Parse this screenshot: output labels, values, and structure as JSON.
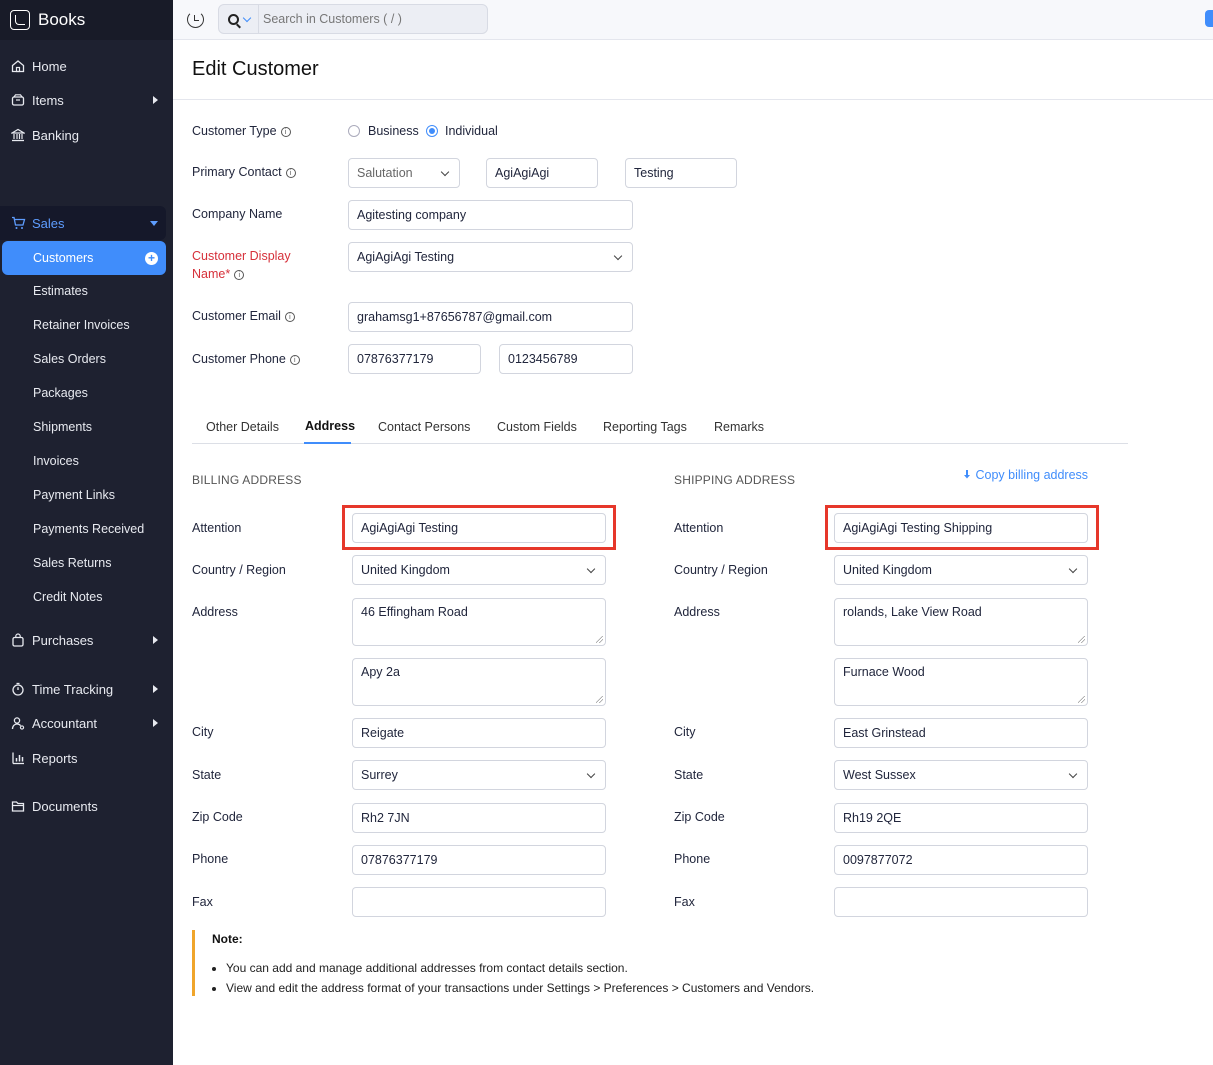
{
  "brand": {
    "name": "Books"
  },
  "topbar": {
    "search_placeholder": "Search in Customers ( / )"
  },
  "nav": {
    "home": "Home",
    "items": "Items",
    "banking": "Banking",
    "sales": "Sales",
    "sales_items": [
      "Customers",
      "Estimates",
      "Retainer Invoices",
      "Sales Orders",
      "Packages",
      "Shipments",
      "Invoices",
      "Payment Links",
      "Payments Received",
      "Sales Returns",
      "Credit Notes"
    ],
    "purchases": "Purchases",
    "time_tracking": "Time Tracking",
    "accountant": "Accountant",
    "reports": "Reports",
    "documents": "Documents"
  },
  "page": {
    "title": "Edit Customer"
  },
  "form": {
    "customer_type_label": "Customer Type",
    "type_business": "Business",
    "type_individual": "Individual",
    "selected_type": "Individual",
    "primary_contact_label": "Primary Contact",
    "salutation": "Salutation",
    "first_name": "AgiAgiAgi",
    "last_name": "Testing",
    "company_name_label": "Company Name",
    "company_name": "Agitesting company",
    "display_name_label_1": "Customer Display",
    "display_name_label_2": "Name*",
    "display_name": "AgiAgiAgi Testing",
    "email_label": "Customer Email",
    "email": "grahamsg1+87656787@gmail.com",
    "phone_label": "Customer Phone",
    "work_phone": "07876377179",
    "mobile_phone": "0123456789"
  },
  "tabs": [
    "Other Details",
    "Address",
    "Contact Persons",
    "Custom Fields",
    "Reporting Tags",
    "Remarks"
  ],
  "active_tab": "Address",
  "labels": {
    "attention": "Attention",
    "country": "Country / Region",
    "address": "Address",
    "city": "City",
    "state": "State",
    "zip": "Zip Code",
    "phone": "Phone",
    "fax": "Fax"
  },
  "billing": {
    "title": "BILLING ADDRESS",
    "attention": "AgiAgiAgi Testing",
    "country": "United Kingdom",
    "street1": "46 Effingham Road",
    "street2": "Apy 2a",
    "city": "Reigate",
    "state": "Surrey",
    "zip": "Rh2 7JN",
    "phone": "07876377179",
    "fax": ""
  },
  "shipping": {
    "title": "SHIPPING ADDRESS",
    "copy_link": "Copy billing address",
    "attention": "AgiAgiAgi Testing Shipping",
    "country": "United Kingdom",
    "street1": "rolands, Lake View Road",
    "street2": "Furnace Wood",
    "city": "East Grinstead",
    "state": "West Sussex",
    "zip": "Rh19 2QE",
    "phone": "0097877072",
    "fax": ""
  },
  "note": {
    "title": "Note:",
    "items": [
      "You can add and manage additional addresses from contact details section.",
      "View and edit the address format of your transactions under Settings > Preferences > Customers and Vendors."
    ]
  },
  "colors": {
    "accent": "#408dfb",
    "sidebar": "#1e2130",
    "highlight": "#e6372a",
    "required": "#d6303a"
  }
}
